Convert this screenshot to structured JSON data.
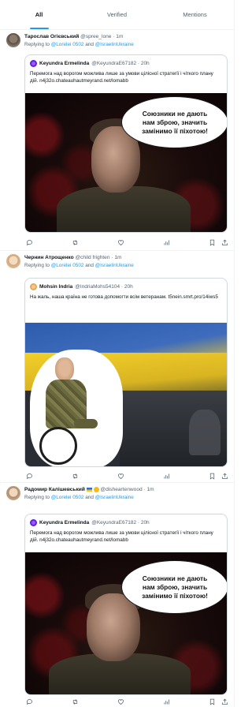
{
  "tabs": [
    {
      "label": "All",
      "active": true
    },
    {
      "label": "Verified",
      "active": false
    },
    {
      "label": "Mentions",
      "active": false
    }
  ],
  "tweets": [
    {
      "author_name": "Тарослав Огієвський",
      "author_handle": "@spree_lone · 1m",
      "replying_prefix": "Replying to",
      "reply_user1": "@Lorelei 0502",
      "reply_and": "and",
      "reply_user2": "@IsraelinUkraine",
      "quote": {
        "name": "Keyundra Ermelinda",
        "handle": "@KeyundraE67182 · 20h",
        "text": "Перемога над ворогом можлива лише за умови цілісної стратегії і чіткого плану дій. n4j32o.chateauhautmeyrand.net/lomabb",
        "bubble_lines": [
          "Союзники не дають",
          "нам зброю, значить",
          "замінимо її піхотою!"
        ]
      }
    },
    {
      "author_name": "Чернин Атрощенко",
      "author_handle": "@child frighten · 1m",
      "replying_prefix": "Replying to",
      "reply_user1": "@Lorelei 0502",
      "reply_and": "and",
      "reply_user2": "@IsraelinUkraine",
      "quote": {
        "name": "Mohsin Indria",
        "handle": "@IndriaMohs54104 · 20h",
        "text": "На жаль, наша країна не готова допомогти всім ветеранам. t5nein.smrt.pro/14iws5"
      }
    },
    {
      "author_name": "Радомир Калішевський",
      "author_handle": "@disheartenwood · 1m",
      "replying_prefix": "Replying to",
      "reply_user1": "@Lorelei 0502",
      "reply_and": "and",
      "reply_user2": "@IsraelinUkraine",
      "quote": {
        "name": "Keyundra Ermelinda",
        "handle": "@KeyundraE67182 · 20h",
        "text": "Перемога над ворогом можлива лише за умови цілісної стратегії і чіткого плану дій. n4j32o.chateauhautmeyrand.net/lomabb",
        "bubble_lines": [
          "Союзники не дають",
          "нам зброю, значить",
          "замінимо її піхотою!"
        ]
      }
    }
  ],
  "action_icons": [
    "reply-icon",
    "retweet-icon",
    "like-icon",
    "views-icon",
    "bookmark-icon",
    "share-icon"
  ],
  "colors": {
    "accent": "#1d9bf0",
    "muted": "#536471",
    "border": "#cfd9de"
  }
}
